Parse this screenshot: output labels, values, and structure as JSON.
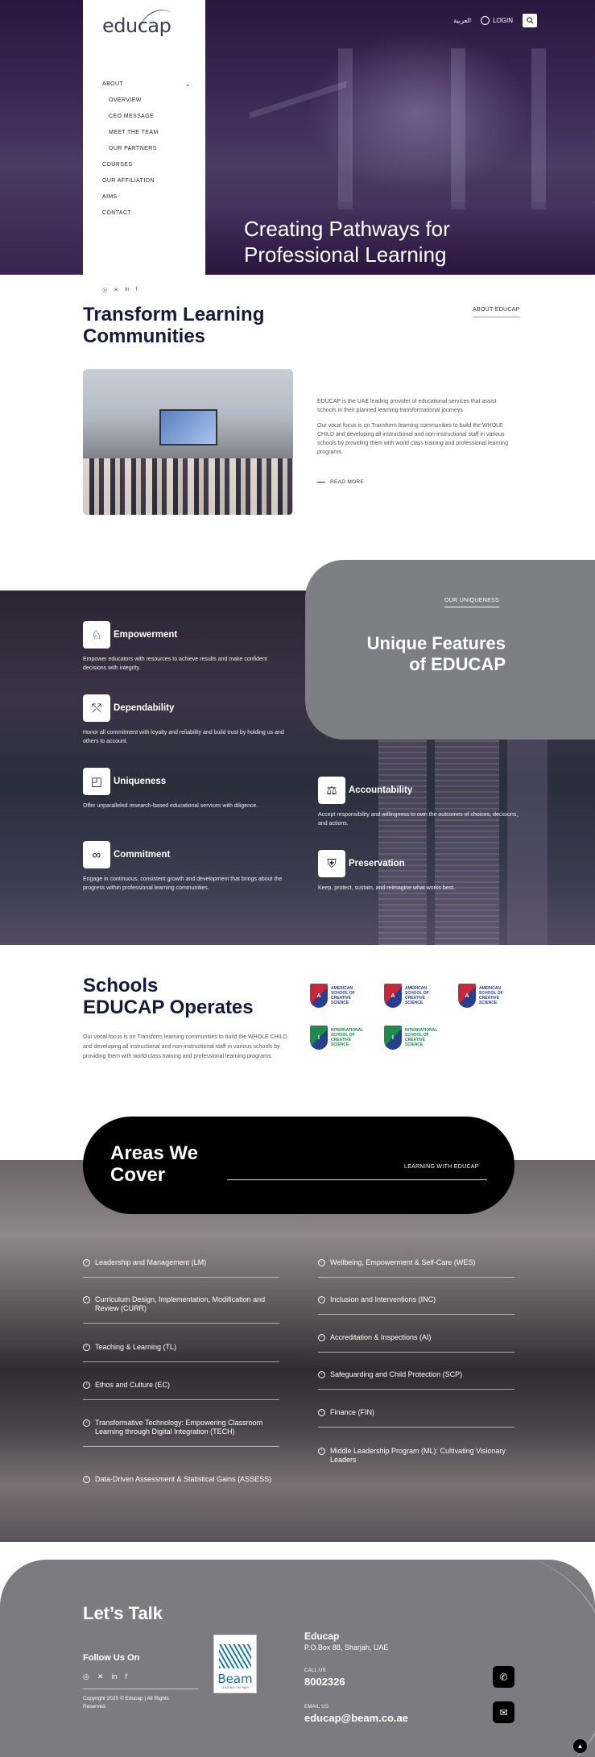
{
  "header": {
    "logo_text": "educap",
    "lang_label": "العربية",
    "login_label": "LOGIN",
    "hero_title": "Creating Pathways for Professional Learning"
  },
  "nav": {
    "items": [
      {
        "label": "ABOUT",
        "sub": false,
        "has_chevron": true
      },
      {
        "label": "OVERVIEW",
        "sub": true
      },
      {
        "label": "CEO MESSAGE",
        "sub": true
      },
      {
        "label": "MEET THE TEAM",
        "sub": true
      },
      {
        "label": "OUR PARTNERS",
        "sub": true
      },
      {
        "label": "COURSES",
        "sub": false
      },
      {
        "label": "OUR AFFILIATION",
        "sub": false
      },
      {
        "label": "AIMS",
        "sub": false
      },
      {
        "label": "CONTACT",
        "sub": false
      }
    ],
    "social": [
      "instagram-icon",
      "x-icon",
      "linkedin-icon",
      "facebook-icon"
    ]
  },
  "about": {
    "title": "Transform Learning Communities",
    "tag": "ABOUT EDUCAP",
    "p1": "EDUCAP is the UAE leading provider of educational services that assist schools in their planned learning transformational journeys.",
    "p2": "Our vocal focus is on Transform learning communities to build the WHOLE CHILD and developing all instructional and non-instructional staff in various schools by providing them with world class training and professional learning programs.",
    "read_more": "READ MORE"
  },
  "uniqueness": {
    "tag": "OUR UNIQUENESS",
    "title": "Unique Features of EDUCAP",
    "features": [
      {
        "name": "Empowerment",
        "desc": "Empower educators with resources to achieve results and make confident decisions with integrity.",
        "icon": "empowerment-icon"
      },
      {
        "name": "Dependability",
        "desc": "Honor all commitment with loyalty and reliability and build trust by holding us and others to account.",
        "icon": "dependability-icon"
      },
      {
        "name": "Uniqueness",
        "desc": "Offer unparalleled research-based educational services with diligence.",
        "icon": "uniqueness-icon"
      },
      {
        "name": "Commitment",
        "desc": "Engage in continuous, consistent growth and development that brings about the progress within professional learning communities.",
        "icon": "commitment-icon"
      },
      {
        "name": "Accountability",
        "desc": "Accept responsibility and willingness to own the outcomes of choices, decisions, and actions.",
        "icon": "accountability-icon"
      },
      {
        "name": "Preservation",
        "desc": "Keep, protect, sustain, and reimagine what works best.",
        "icon": "preservation-icon"
      }
    ]
  },
  "schools": {
    "title_line1": "Schools",
    "title_line2": "EDUCAP Operates",
    "text": "Our vocal focus is on Transform learning communities to build the WHOLE CHILD and developing all instructional and non-instructional staff in various schools by providing them with world class training and professional learning programs.",
    "logos": [
      {
        "name": "American School of Creative Science",
        "color": "red"
      },
      {
        "name": "American School of Creative Science",
        "color": "red"
      },
      {
        "name": "American School of Creative Science",
        "color": "red"
      },
      {
        "name": "International School of Creative Science",
        "color": "green"
      },
      {
        "name": "International School of Creative Science",
        "color": "green"
      }
    ]
  },
  "areas": {
    "title_line1": "Areas We",
    "title_line2": "Cover",
    "tag": "LEARNING WITH EDUCAP",
    "left": [
      "Leadership and Management (LM)",
      "Curriculum Design, Implementation, Modification and Review (CURR)",
      "Teaching & Learning (TL)",
      "Ethos and Culture (EC)",
      "Transformative Technology: Empowering Classroom Learning through Digital Integration (TECH)",
      "Data-Driven Assessment & Statistical Gains (ASSESS)"
    ],
    "right": [
      "Wellbeing, Empowerment & Self-Care (WES)",
      "Inclusion and Interventions (INC)",
      "Accreditation & Inspections (AI)",
      "Safeguarding and Child Protection (SCP)",
      "Finance (FIN)",
      "Middle Leadership Program (ML): Cultivating Visionary Leaders"
    ]
  },
  "footer": {
    "lets_talk": "Let’s Talk",
    "follow": "Follow Us On",
    "copyright": "Copyright 2025 © Educap | All Rights Reserved",
    "beam_title": "Beam",
    "beam_sub": "LEADING THE WAY",
    "company": "Educap",
    "address": "P.O.Box 88, Sharjah, UAE",
    "call_label": "CALL US",
    "phone": "8002326",
    "email_label": "EMAIL US",
    "email": "educap@beam.co.ae"
  }
}
